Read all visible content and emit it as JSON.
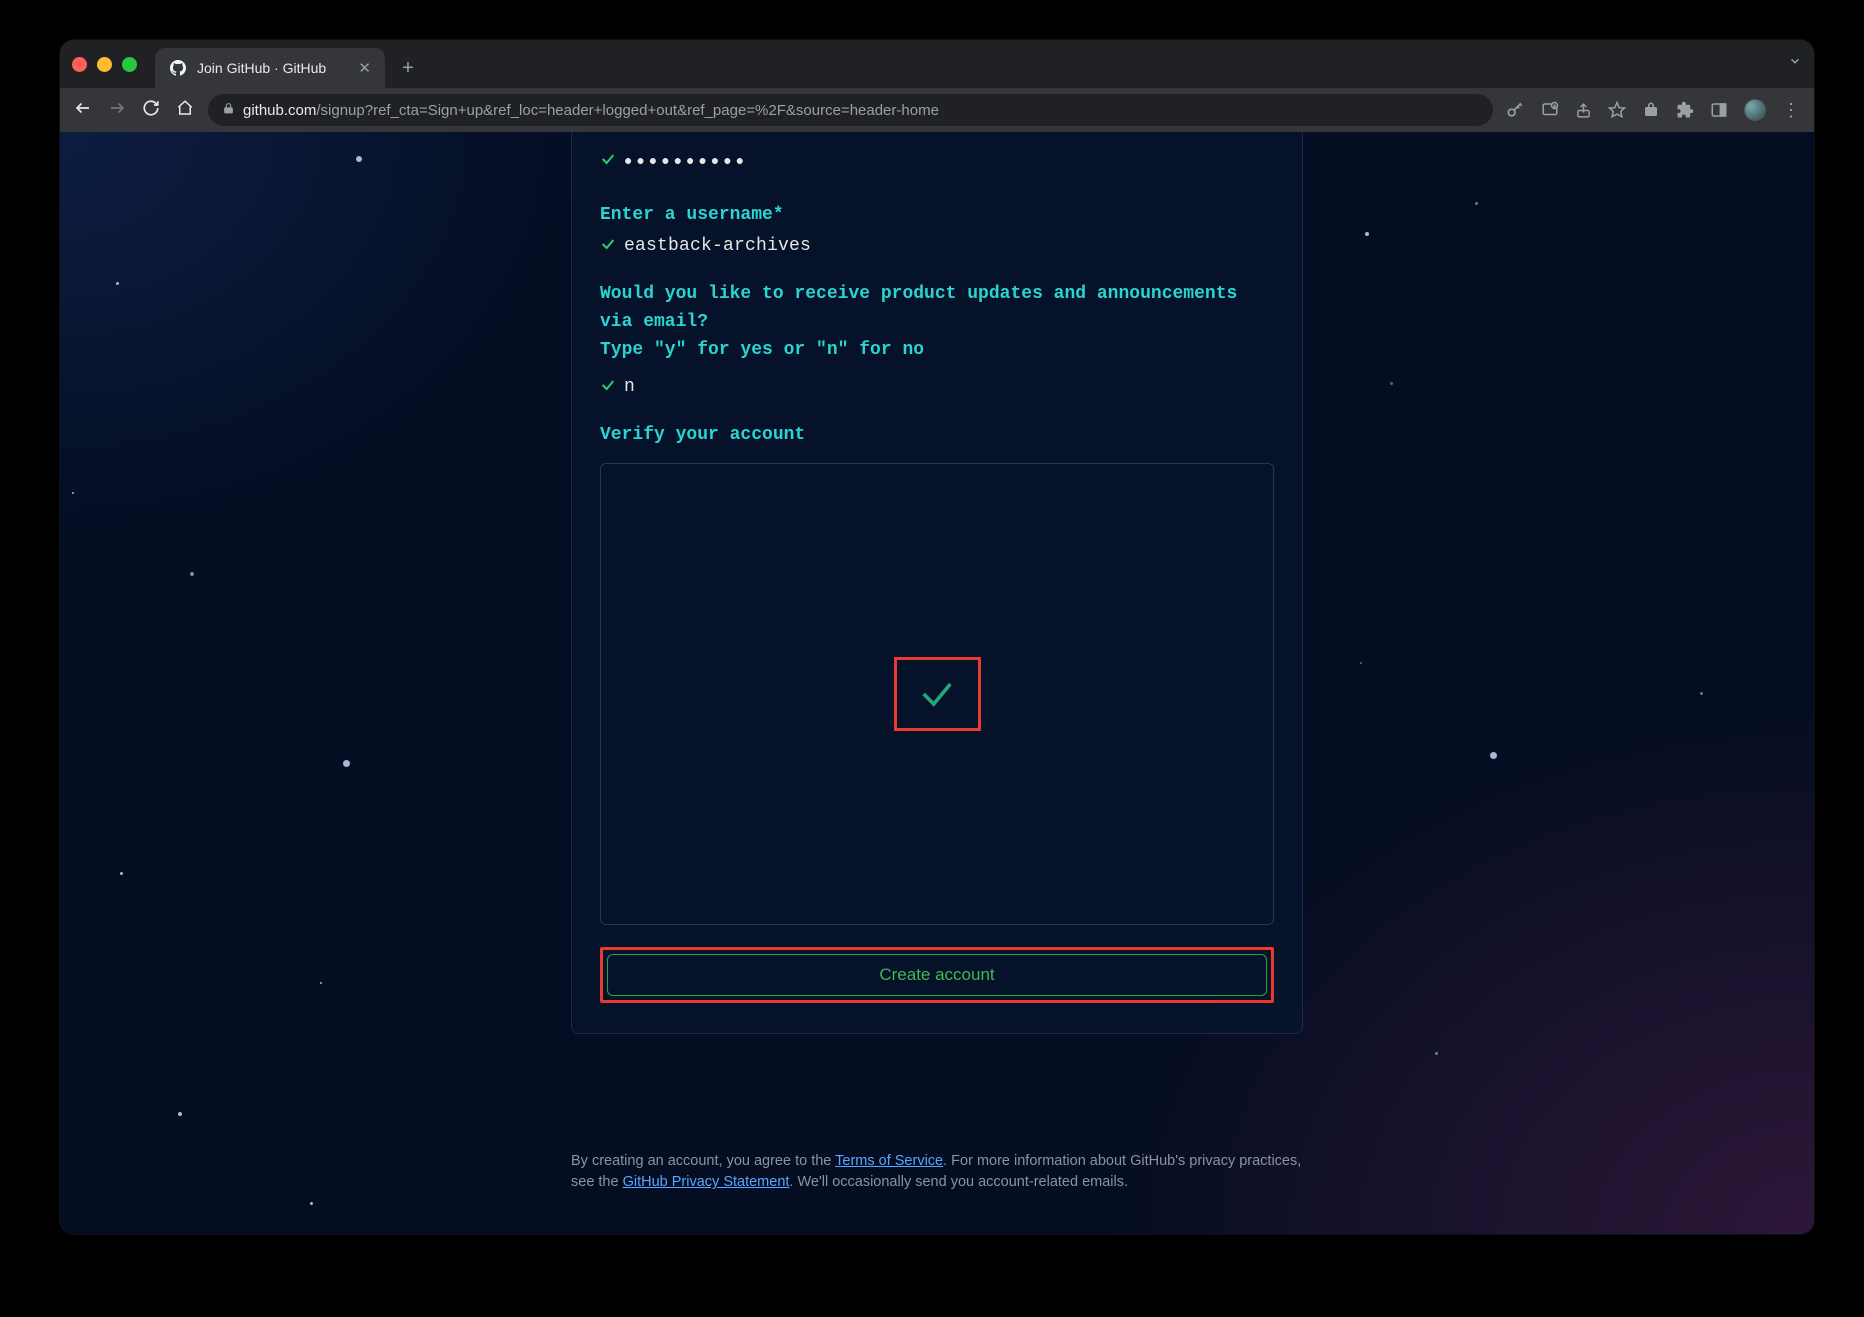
{
  "browser": {
    "tab_title": "Join GitHub · GitHub",
    "url_host": "github.com",
    "url_path": "/signup?ref_cta=Sign+up&ref_loc=header+logged+out&ref_page=%2F&source=header-home"
  },
  "signup": {
    "password_masked": "●●●●●●●●●●",
    "username_prompt": "Enter a username*",
    "username_value": "eastback-archives",
    "updates_prompt_line1": "Would you like to receive product updates and announcements via email?",
    "updates_prompt_line2": "Type \"y\" for yes or \"n\" for no",
    "updates_value": "n",
    "verify_prompt": "Verify your account",
    "create_button_label": "Create account"
  },
  "legal": {
    "prefix": "By creating an account, you agree to the ",
    "tos_link": "Terms of Service",
    "mid": ". For more information about GitHub's privacy practices, see the ",
    "privacy_link": "GitHub Privacy Statement",
    "suffix": ". We'll occasionally send you account-related emails."
  },
  "colors": {
    "accent_teal": "#2bd4d0",
    "accent_green": "#2ea043",
    "highlight_red": "#e83a2f"
  }
}
